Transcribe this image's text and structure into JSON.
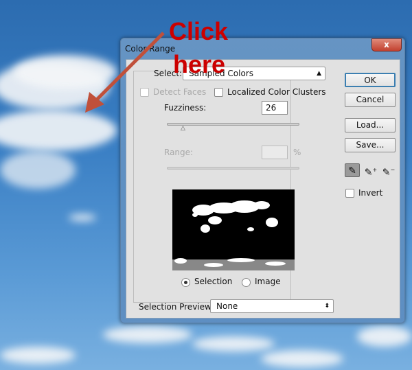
{
  "annotation": {
    "line1": "Click",
    "line2": "here",
    "color": "#cc0000",
    "arrow_color": "#c0503a"
  },
  "dialog": {
    "title": "Color Range",
    "close_label": "x",
    "select_label": "Select:",
    "select_value": "Sampled Colors",
    "detect_faces": {
      "label": "Detect Faces",
      "checked": false,
      "disabled": true
    },
    "localized_clusters": {
      "label": "Localized Color Clusters",
      "checked": false
    },
    "fuzziness_label": "Fuzziness:",
    "fuzziness_value": "26",
    "fuzziness_percent_of_max": 13,
    "range_label": "Range:",
    "range_value": "",
    "range_unit": "%",
    "view_options": [
      {
        "label": "Selection",
        "selected": true
      },
      {
        "label": "Image",
        "selected": false
      }
    ],
    "preview_label": "Selection Preview:",
    "preview_value": "None",
    "buttons": {
      "ok": "OK",
      "cancel": "Cancel",
      "load": "Load...",
      "save": "Save..."
    },
    "eyedroppers": [
      "eyedropper-icon",
      "eyedropper-plus-icon",
      "eyedropper-minus-icon"
    ],
    "invert": {
      "label": "Invert",
      "checked": false
    }
  }
}
